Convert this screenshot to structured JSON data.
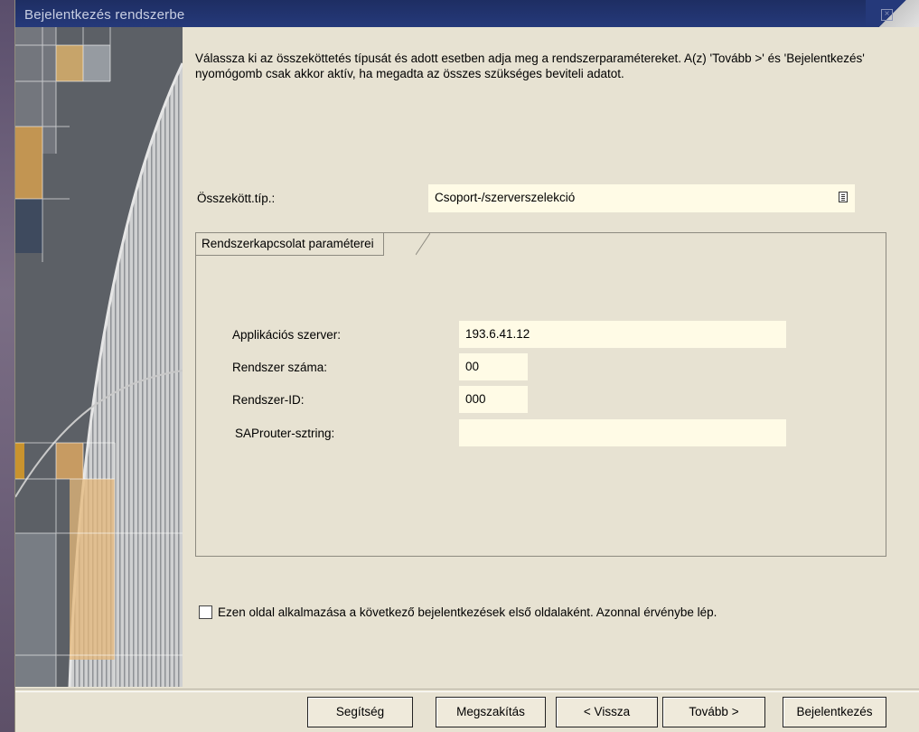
{
  "window": {
    "title": "Bejelentkezés rendszerbe",
    "intro_text": "Válassza ki az összeköttetés típusát és adott esetben adja meg a rendszerparamétereket. A(z) 'Tovább >' és 'Bejelentkezés' nyomógomb csak akkor aktív, ha megadta az összes szükséges beviteli adatot."
  },
  "connection": {
    "type_label": "Összekött.típ.:",
    "type_value": "Csoport-/szerverszelekció"
  },
  "group": {
    "title": "Rendszerkapcsolat paraméterei",
    "fields": [
      {
        "label": "Applikációs szerver:",
        "value": "193.6.41.12"
      },
      {
        "label": "Rendszer száma:",
        "value": "00"
      },
      {
        "label": "Rendszer-ID:",
        "value": "000"
      },
      {
        "label": "SAProuter-sztring:",
        "value": ""
      }
    ]
  },
  "checkbox": {
    "label": "Ezen oldal alkalmazása a következő bejelentkezések első oldalaként. Azonnal érvénybe lép.",
    "checked": false
  },
  "buttons": {
    "help": "Segítség",
    "cancel": "Megszakítás",
    "back": "< Vissza",
    "next": "Tovább >",
    "login": "Bejelentkezés"
  },
  "colors": {
    "titlebar": "#1e2e63",
    "dialog_bg": "#e7e2d2",
    "input_bg": "#fffbe6"
  }
}
